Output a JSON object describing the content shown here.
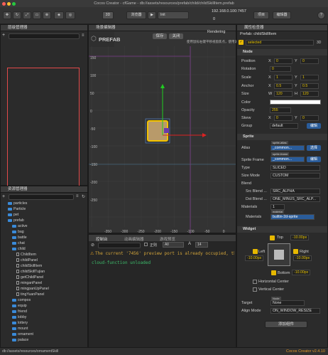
{
  "app": {
    "title": "Cocos Creator - cfGame - db://assets/resources/prefab/child/childSkillItem.prefab",
    "version": "Cocos Creator v2.4.10",
    "status_path": "db://assets/resources/ornamentSkill"
  },
  "toolbar": {
    "platform": "浏览器",
    "scene_select": "Init",
    "ip": "192.168.0.100:7457",
    "count": "0",
    "label_3d": "3D",
    "preview_btn": "项目",
    "editor_btn": "编辑器",
    "help": "?"
  },
  "hierarchy": {
    "title": "层级管理器"
  },
  "assets": {
    "title": "资源管理器",
    "items": [
      {
        "label": "particles",
        "type": "folder",
        "depth": 1
      },
      {
        "label": "Particle",
        "type": "folder",
        "depth": 1
      },
      {
        "label": "pet",
        "type": "folder",
        "depth": 1
      },
      {
        "label": "prefab",
        "type": "folder",
        "depth": 1
      },
      {
        "label": "active",
        "type": "folder",
        "depth": 2
      },
      {
        "label": "bag",
        "type": "folder",
        "depth": 2
      },
      {
        "label": "battle",
        "type": "folder",
        "depth": 2
      },
      {
        "label": "chat",
        "type": "folder",
        "depth": 2
      },
      {
        "label": "child",
        "type": "folder",
        "depth": 2
      },
      {
        "label": "ChildItem",
        "type": "file",
        "depth": 3
      },
      {
        "label": "childPanel",
        "type": "file",
        "depth": 3
      },
      {
        "label": "childSkillItem",
        "type": "file",
        "depth": 3
      },
      {
        "label": "childSkillTujian",
        "type": "file",
        "depth": 3
      },
      {
        "label": "getChildPanel",
        "type": "file",
        "depth": 3
      },
      {
        "label": "minganPanel",
        "type": "file",
        "depth": 3
      },
      {
        "label": "mingpanUpPanel",
        "type": "file",
        "depth": 3
      },
      {
        "label": "tingYuanPanel",
        "type": "file",
        "depth": 3
      },
      {
        "label": "compos",
        "type": "folder",
        "depth": 2
      },
      {
        "label": "equip",
        "type": "folder",
        "depth": 2
      },
      {
        "label": "friend",
        "type": "folder",
        "depth": 2
      },
      {
        "label": "lobby",
        "type": "folder",
        "depth": 2
      },
      {
        "label": "lottery",
        "type": "folder",
        "depth": 2
      },
      {
        "label": "mount",
        "type": "folder",
        "depth": 2
      },
      {
        "label": "ornament",
        "type": "folder",
        "depth": 2
      },
      {
        "label": "palace",
        "type": "folder",
        "depth": 2
      }
    ]
  },
  "scene": {
    "title": "场景编辑器",
    "prefab_label": "PREFAB",
    "save": "保存",
    "close": "关闭",
    "hint": "使用鼠标右键平移视窗焦点，使用滚轮缩放视图",
    "rendering": "Rendering",
    "x_ticks": [
      "-350",
      "-300",
      "-250",
      "-200",
      "-150",
      "-100",
      "-50",
      "0",
      "50"
    ],
    "y_ticks": [
      "150",
      "100",
      "50",
      "0",
      "-50",
      "-100",
      "-150",
      "-200",
      "-250"
    ]
  },
  "console": {
    "tabs": [
      "控制台",
      "动画编辑器",
      "游戏预览"
    ],
    "level": "All",
    "fontsize": "14",
    "filter_label": "正则",
    "lines": [
      "The current '7456' preview port is already occupied, th",
      "cloud-function unloaded"
    ]
  },
  "inspector": {
    "title": "属性检查器",
    "prefab_name": "Prefab: childSkillItem",
    "node_name": "selected",
    "node_label": "Node",
    "label_3d": "3D",
    "pos": {
      "label": "Position",
      "x": "0",
      "y": "0"
    },
    "rot": {
      "label": "Rotation",
      "v": "0"
    },
    "scale": {
      "label": "Scale",
      "x": "1",
      "y": "1"
    },
    "anchor": {
      "label": "Anchor",
      "x": "0.5",
      "y": "0.5"
    },
    "size": {
      "label": "Size",
      "w": "120",
      "h": "120"
    },
    "color": {
      "label": "Color"
    },
    "opacity": {
      "label": "Opacity",
      "v": "255"
    },
    "skew": {
      "label": "Skew",
      "x": "0",
      "y": "0"
    },
    "group": {
      "label": "Group",
      "v": "default",
      "btn": "编辑"
    },
    "sprite": {
      "label": "Sprite",
      "atlas": "Atlas",
      "atlas_tag": "sprite-atlas",
      "atlas_val": "_common...",
      "atlas_btn": "选择",
      "frame": "Sprite Frame",
      "frame_tag": "sprite-frame",
      "frame_val": "_common...",
      "frame_btn": "编辑",
      "type": "Type",
      "type_v": "SLICED",
      "sizemode": "Size Mode",
      "sizemode_v": "CUSTOM",
      "blend": "Blend",
      "src": "Src Blend ...",
      "src_v": "SRC_ALPHA",
      "dst": "Dst Blend ...",
      "dst_v": "ONE_MINUS_SRC_ALP...",
      "materials": "Materials",
      "mat_count": "1",
      "mat_label": "Materials",
      "mat_tag": "material",
      "mat_val": "builtin-2d-sprite"
    },
    "widget": {
      "label": "Widget",
      "top": "Top",
      "top_v": "-10.00px",
      "left": "Left",
      "left_v": "-10.00px",
      "right": "Right",
      "right_v": "-10.00px",
      "bottom": "Bottom",
      "bottom_v": "-10.00px",
      "hcenter": "Horizontal Center",
      "vcenter": "Vertical Center",
      "target": "Target",
      "target_tag": "Node",
      "target_val": "None",
      "align": "Align Mode",
      "align_v": "ON_WINDOW_RESIZE",
      "add_btn": "添加组件"
    }
  }
}
